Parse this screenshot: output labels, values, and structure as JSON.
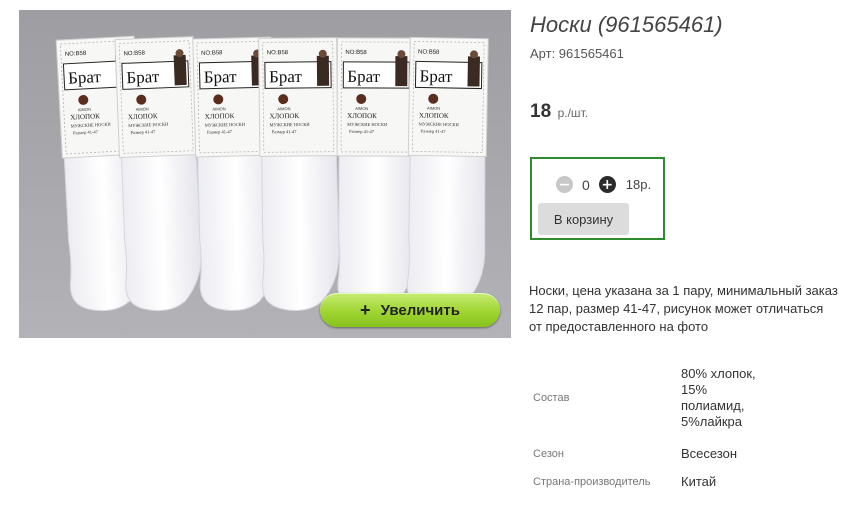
{
  "product": {
    "title": "Носки (961565461)",
    "sku_label": "Арт: 961565461",
    "price_value": "18",
    "price_unit": "р./шт.",
    "description": "Носки, цена указана за 1 пару, минимальный заказ 12 пар, размер 41-47, рисунок может отличаться от предоставленного на фото"
  },
  "gallery": {
    "zoom_icon": "+",
    "zoom_label": "Увеличить",
    "sock_brand": "Брат",
    "sock_code": "NO:B58",
    "sock_material": "ХЛОПОК",
    "sock_type": "МУЖСКИЕ НОСКИ",
    "sock_size": "Размер 41-47",
    "sock_logo": "AIMON",
    "colors": {
      "background": "#a9a9ad",
      "sock": "#ffffff",
      "zoom_button": "#9fd531"
    }
  },
  "cart": {
    "minus_icon": "−",
    "plus_icon": "+",
    "quantity": "0",
    "sum": "18р.",
    "add_label": "В корзину",
    "border_color": "#2e8b2e"
  },
  "properties": [
    {
      "key": "Состав",
      "value": "80% хлопок, 15% полиамид, 5%лайкра"
    },
    {
      "key": "Сезон",
      "value": "Всесезон"
    },
    {
      "key": "Страна-производитель",
      "value": "Китай"
    }
  ]
}
